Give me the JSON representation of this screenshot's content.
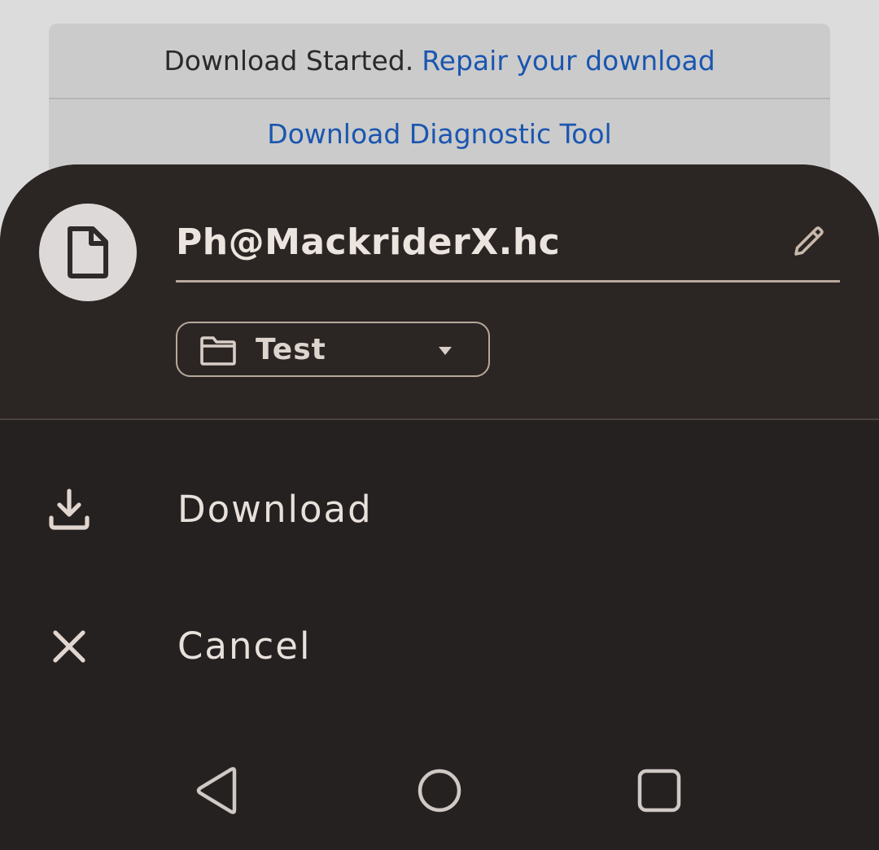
{
  "banner": {
    "status_text": "Download Started.",
    "repair_link": "Repair your download",
    "diagnostic_link": "Download Diagnostic Tool"
  },
  "sheet": {
    "file_icon": "file-icon",
    "file_name": "Ph@MackriderX.hc",
    "edit_icon": "pencil-icon",
    "folder": {
      "icon": "folder-icon",
      "selected": "Test",
      "dropdown_icon": "caret-down-icon"
    },
    "actions": [
      {
        "icon": "download-icon",
        "label": "Download"
      },
      {
        "icon": "close-icon",
        "label": "Cancel"
      }
    ]
  },
  "navbar": {
    "back_icon": "back-triangle-icon",
    "home_icon": "home-circle-icon",
    "recents_icon": "recents-square-icon"
  },
  "colors": {
    "sheet_background": "#252120",
    "header_background": "#2b2624",
    "link_blue": "#1a56b0",
    "accent_outline": "#b8a89b"
  }
}
